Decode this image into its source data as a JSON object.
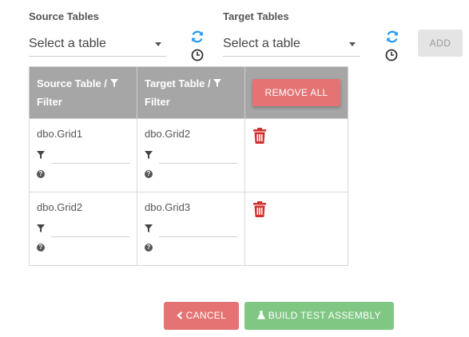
{
  "source": {
    "label": "Source Tables",
    "select_value": "Select a table"
  },
  "target": {
    "label": "Target Tables",
    "select_value": "Select a table"
  },
  "add_label": "ADD",
  "table": {
    "headers": [
      "Source Table /",
      "Filter",
      "Target Table /",
      "Filter"
    ],
    "remove_all_label": "REMOVE ALL",
    "rows": [
      {
        "source": "dbo.Grid1",
        "target": "dbo.Grid2"
      },
      {
        "source": "dbo.Grid2",
        "target": "dbo.Grid3"
      }
    ]
  },
  "footer": {
    "cancel_label": "CANCEL",
    "build_label": "BUILD TEST ASSEMBLY"
  },
  "colors": {
    "refresh": "#2196f3",
    "danger": "#e57373",
    "success": "#81c784",
    "trash": "#d32f2f",
    "header_bg": "#a6a6a6"
  },
  "icons": [
    "refresh-icon",
    "history-icon",
    "filter-icon",
    "help-icon",
    "trash-icon",
    "chevron-left-icon",
    "flask-icon"
  ]
}
